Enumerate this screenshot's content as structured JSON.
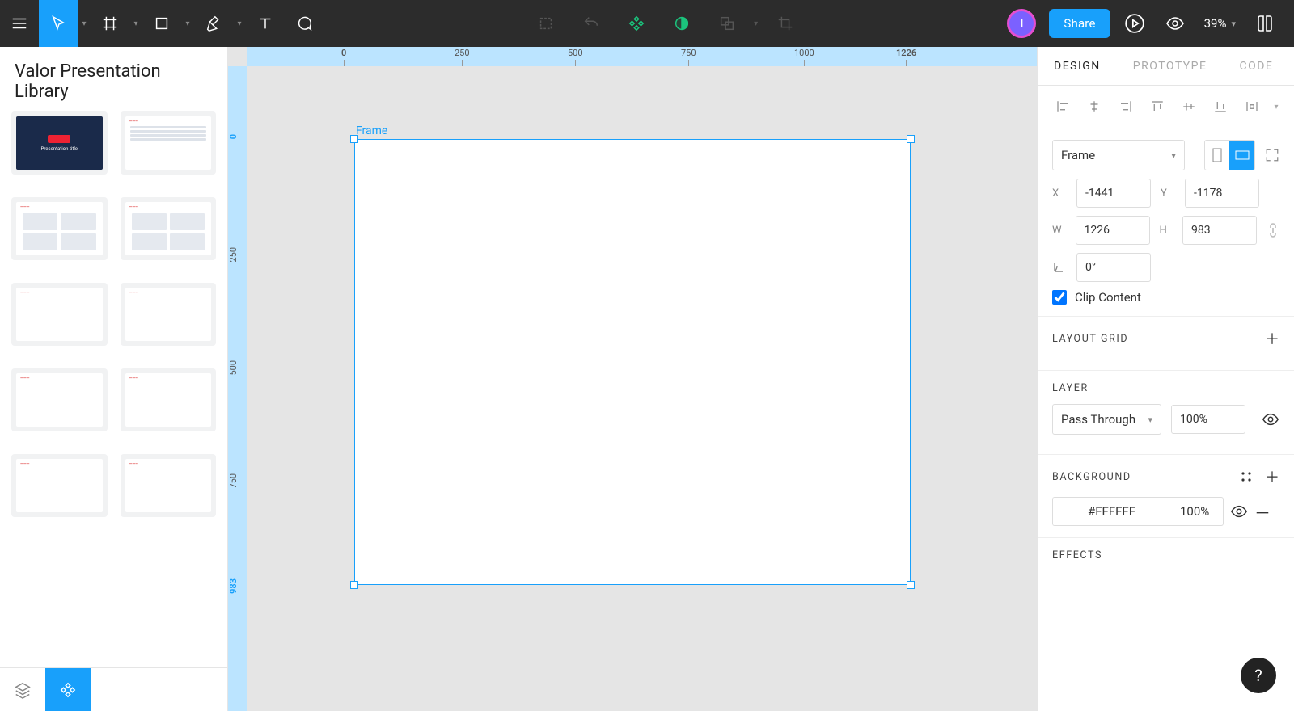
{
  "toolbar": {
    "share_label": "Share",
    "zoom": "39%",
    "avatar_letter": "I"
  },
  "left_panel": {
    "title": "Valor Presentation Library",
    "cover_title": "Presentation title"
  },
  "canvas": {
    "frame_label": "Frame",
    "ruler_h": [
      "0",
      "250",
      "500",
      "750",
      "1000",
      "1226"
    ],
    "ruler_v": [
      "0",
      "250",
      "500",
      "750",
      "983"
    ]
  },
  "design_panel": {
    "tabs": {
      "design": "DESIGN",
      "prototype": "PROTOTYPE",
      "code": "CODE"
    },
    "frame_type": "Frame",
    "x": "-1441",
    "y": "-1178",
    "w": "1226",
    "h": "983",
    "rotation": "0°",
    "clip_content_label": "Clip Content",
    "clip_content_checked": true,
    "sections": {
      "layout_grid": "LAYOUT GRID",
      "layer": "LAYER",
      "background": "BACKGROUND",
      "effects": "EFFECTS"
    },
    "blend_mode": "Pass Through",
    "layer_opacity": "100%",
    "bg_hex": "#FFFFFF",
    "bg_opacity": "100%"
  },
  "labels": {
    "x": "X",
    "y": "Y",
    "w": "W",
    "h": "H",
    "angle": "⌐"
  },
  "help": "?"
}
